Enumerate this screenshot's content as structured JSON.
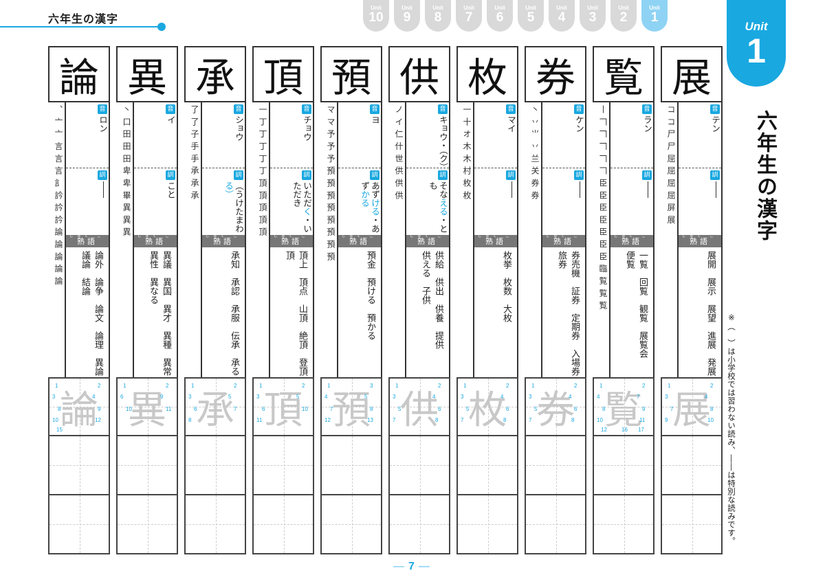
{
  "header": {
    "title": "六年生の漢字"
  },
  "unit_tabs": [
    {
      "label": "Unit",
      "number": "10",
      "active": false
    },
    {
      "label": "Unit",
      "number": "9",
      "active": false
    },
    {
      "label": "Unit",
      "number": "8",
      "active": false
    },
    {
      "label": "Unit",
      "number": "7",
      "active": false
    },
    {
      "label": "Unit",
      "number": "6",
      "active": false
    },
    {
      "label": "Unit",
      "number": "5",
      "active": false
    },
    {
      "label": "Unit",
      "number": "4",
      "active": false
    },
    {
      "label": "Unit",
      "number": "3",
      "active": false
    },
    {
      "label": "Unit",
      "number": "2",
      "active": false
    },
    {
      "label": "Unit",
      "number": "1",
      "active": true
    }
  ],
  "current_unit": {
    "label": "Unit",
    "number": "1"
  },
  "side_title": "六年生の漢字",
  "side_note": "※（　）は小学校では習わない読み、――は特別な読みです。",
  "labels": {
    "on_badge": "音",
    "kun_badge": "訓",
    "jukugo": "熟語",
    "jukugo_furigana": "じゅく ご"
  },
  "colors": {
    "accent": "#1aa8e0",
    "accent_light": "#8fd3f4",
    "tab_inactive": "#d9d9d9",
    "jukugo_bar": "#777777",
    "trace_gray": "#c8c8c8"
  },
  "kanji": [
    {
      "char": "論",
      "stroke_order": "、 亠 亠 言 言 言 訁 訡 訡 訡 論 論 論 論 論",
      "on": "ロン",
      "kun": "―",
      "kun_is_dash": true,
      "words": [
        "論外",
        "論争",
        "論文",
        "論理",
        "異論",
        "議論",
        "結論"
      ],
      "stroke_numbers": [
        "1",
        "2",
        "3",
        "4",
        "8",
        "9",
        "10",
        "12",
        "15"
      ]
    },
    {
      "char": "異",
      "stroke_order": "丶 口 田 田 田 卑 卑 畢 異 異 異",
      "on": "イ",
      "kun": "こと",
      "kun_is_dash": false,
      "words": [
        "異議",
        "異国",
        "異才",
        "異種",
        "異常",
        "異性",
        "異なる"
      ],
      "stroke_numbers": [
        "1",
        "2",
        "6",
        "9",
        "10",
        "11"
      ]
    },
    {
      "char": "承",
      "stroke_order": "了 了 子 手 手 承 承 承",
      "on": "ショウ",
      "kun": "（うけたまわ",
      "kun_blue": "る）",
      "kun_is_dash": false,
      "words": [
        "承知",
        "承認",
        "承服",
        "伝承",
        "承る"
      ],
      "stroke_numbers": [
        "1",
        "2",
        "3",
        "5",
        "6",
        "7",
        "8"
      ]
    },
    {
      "char": "頂",
      "stroke_order": "一 丁 丁 丁 丁 丁 頂 頂 頂 頂 頂",
      "on": "チョウ",
      "kun": "いただ",
      "kun_blue": "く",
      "kun_tail": "・いただき",
      "kun_is_dash": false,
      "words": [
        "頂上",
        "頂点",
        "山頂",
        "絶頂",
        "登頂",
        "頂"
      ],
      "stroke_numbers": [
        "1",
        "2",
        "3",
        "5",
        "6",
        "10",
        "11"
      ]
    },
    {
      "char": "預",
      "stroke_order": "マ マ 予 予 予 預 預 預 預 預 預 預 預",
      "on": "ヨ",
      "kun": "あず",
      "kun_blue": "ける",
      "kun_tail": "・あず",
      "kun_blue2": "かる",
      "kun_is_dash": false,
      "words": [
        "預金",
        "預ける",
        "預かる"
      ],
      "stroke_numbers": [
        "1",
        "3",
        "4",
        "5",
        "7",
        "8",
        "12",
        "13"
      ]
    },
    {
      "char": "供",
      "stroke_order": "ノ イ 仁 什 世 供 供 供",
      "on": "キョウ・（ク）",
      "kun": "そな",
      "kun_blue": "える",
      "kun_tail": "・とも",
      "kun_is_dash": false,
      "words": [
        "供給",
        "供出",
        "供養",
        "提供",
        "供える",
        "子供"
      ],
      "stroke_numbers": [
        "1",
        "2",
        "3",
        "4",
        "5",
        "6",
        "7",
        "8"
      ]
    },
    {
      "char": "枚",
      "stroke_order": "一 十 オ 木 木 村 枚 枚",
      "on": "マイ",
      "kun": "―",
      "kun_is_dash": true,
      "words": [
        "枚挙",
        "枚数",
        "大枚"
      ],
      "stroke_numbers": [
        "1",
        "2",
        "3",
        "4",
        "5",
        "6",
        "7",
        "8"
      ]
    },
    {
      "char": "券",
      "stroke_order": "丶 丷 ⺌ 丷 兰 关 券 券",
      "on": "ケン",
      "kun": "―",
      "kun_is_dash": true,
      "words": [
        "券売機",
        "証券",
        "定期券",
        "入場券",
        "旅券"
      ],
      "stroke_numbers": [
        "1",
        "2",
        "3",
        "4",
        "5",
        "6",
        "7",
        "8"
      ]
    },
    {
      "char": "覧",
      "stroke_order": "丨 𠃍 𠃍 𠃍 𠃍 𠃍 臣 臣 臣 臣 臣 臣 臣 臨 覧 覧 覧",
      "on": "ラン",
      "kun": "―",
      "kun_is_dash": true,
      "words": [
        "一覧",
        "回覧",
        "観覧",
        "展覧会",
        "便覧"
      ],
      "stroke_numbers": [
        "1",
        "2",
        "4",
        "7",
        "8",
        "9",
        "10",
        "11",
        "12",
        "16",
        "17"
      ]
    },
    {
      "char": "展",
      "stroke_order": "コ コ 尸 尸 屈 屈 屈 屈 屏 展",
      "on": "テン",
      "kun": "―",
      "kun_is_dash": true,
      "words": [
        "展開",
        "展示",
        "展望",
        "進展",
        "発展"
      ],
      "stroke_numbers": [
        "1",
        "2",
        "3",
        "4",
        "7",
        "8",
        "9",
        "10"
      ]
    }
  ],
  "page_number": "7"
}
